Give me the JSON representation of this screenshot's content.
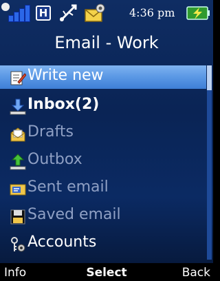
{
  "status": {
    "network_badge": "H",
    "time": "4:36 pm"
  },
  "header": {
    "title": "Email - Work"
  },
  "menu": {
    "items": [
      {
        "label": "Write new",
        "icon": "write-icon",
        "state": "selected"
      },
      {
        "label": "Inbox(2)",
        "icon": "inbox-icon",
        "state": "bold"
      },
      {
        "label": "Drafts",
        "icon": "drafts-icon",
        "state": "dim"
      },
      {
        "label": "Outbox",
        "icon": "outbox-icon",
        "state": "dim"
      },
      {
        "label": "Sent email",
        "icon": "sent-icon",
        "state": "dim"
      },
      {
        "label": "Saved email",
        "icon": "saved-icon",
        "state": "dim"
      },
      {
        "label": "Accounts",
        "icon": "accounts-icon",
        "state": "normal"
      }
    ]
  },
  "softkeys": {
    "left": "Info",
    "center": "Select",
    "right": "Back"
  },
  "colors": {
    "accent": "#5d9ae6",
    "background": "#0b2a63"
  }
}
